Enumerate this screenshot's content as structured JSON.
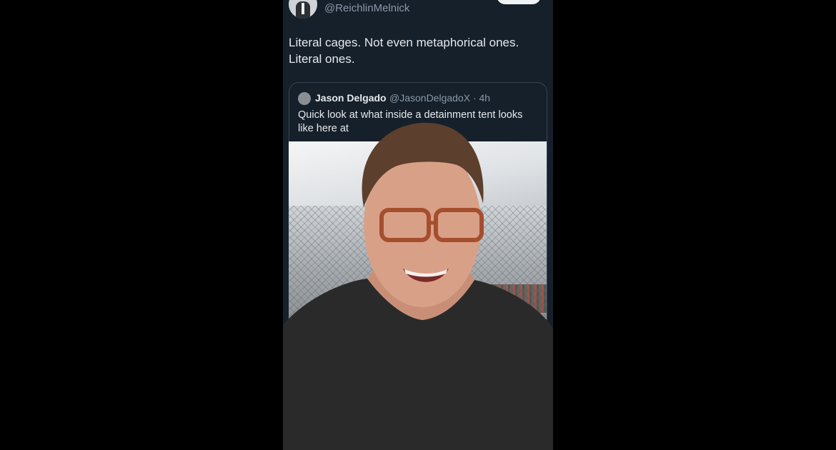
{
  "tweet": {
    "author_handle": "@ReichlinMelnick",
    "text_lines": [
      "Literal cages. Not even metaphorical ones.",
      "Literal ones."
    ]
  },
  "quoted_tweet": {
    "name": "Jason Delgado",
    "handle_time": "@JasonDelgadoX · 4h",
    "text_lines": [
      "Quick look at what inside a detainment tent looks",
      "like here at"
    ]
  },
  "colors": {
    "background": "#000000",
    "card_background": "#15202b",
    "primary_text": "#e7e9ea",
    "secondary_text": "#8b98a5",
    "border": "#38444d"
  }
}
